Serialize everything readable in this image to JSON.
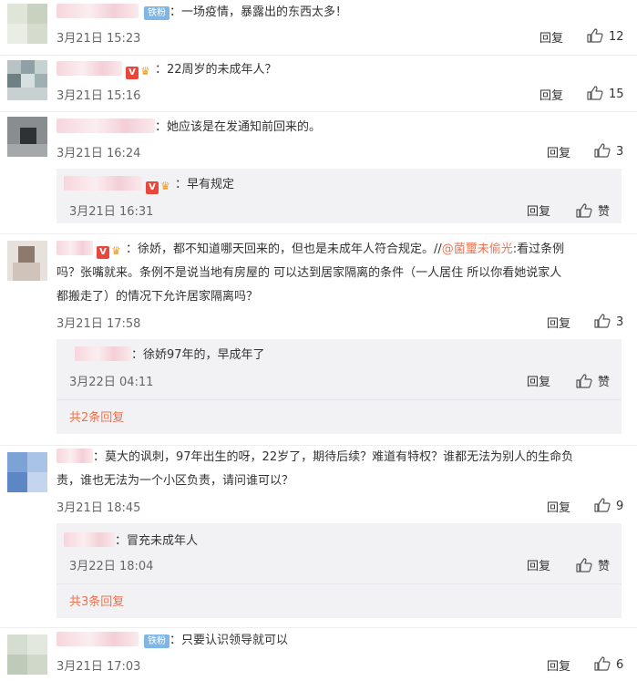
{
  "labels": {
    "reply": "回复",
    "like": "赞"
  },
  "comments": [
    {
      "text": "：一场疫情，暴露出的东西太多！",
      "badge": "铁粉",
      "time": "3月21日 15:23",
      "likes": "12"
    },
    {
      "text": "：22周岁的未成年人？",
      "time": "3月21日 15:16",
      "likes": "15"
    },
    {
      "text": "：她应该是在发通知前回来的。",
      "time": "3月21日 16:24",
      "likes": "3",
      "sub": {
        "text": "：早有规定",
        "time": "3月21日 16:31"
      }
    },
    {
      "text_line1_a": "：徐娇，都不知道哪天回来的，但也是未成年人符合规定。//",
      "mention": "@菌璽未偷光",
      "text_line1_b": ":看过条例",
      "text_line2": "吗？张嘴就来。条例不是说当地有房屋的 可以达到居家隔离的条件（一人居住 所以你看她说家人",
      "text_line3": "都搬走了）的情况下允许居家隔离吗？",
      "time": "3月21日 17:58",
      "likes": "3",
      "sub": {
        "text": "：徐娇97年的，早成年了",
        "time": "3月22日 04:11"
      },
      "more": "共2条回复"
    },
    {
      "text_line1": "：莫大的讽刺，97年出生的呀，22岁了，期待后续？难道有特权？谁都无法为别人的生命负",
      "text_line2": "责，谁也无法为一个小区负责，请问谁可以？",
      "time": "3月21日 18:45",
      "likes": "9",
      "sub": {
        "text": "：冒充未成年人",
        "time": "3月22日 18:04"
      },
      "more": "共3条回复"
    },
    {
      "text": "：只要认识领导就可以",
      "badge": "铁粉",
      "time": "3月21日 17:03",
      "likes": "6"
    }
  ]
}
